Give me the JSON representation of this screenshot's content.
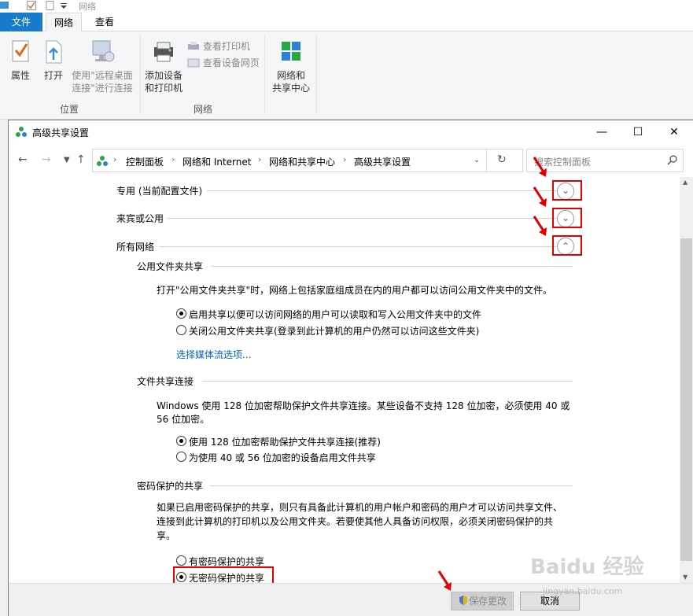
{
  "explorer": {
    "qat_title": "网络",
    "tabs": {
      "file": "文件",
      "network": "网络",
      "view": "查看"
    },
    "buttons": {
      "properties": "属性",
      "open": "打开",
      "remote_line1": "使用\"远程桌面",
      "remote_line2": "连接\"进行连接",
      "add_device_line1": "添加设备",
      "add_device_line2": "和打印机",
      "view_printers": "查看打印机",
      "view_device_page": "查看设备网页",
      "network_center_line1": "网络和",
      "network_center_line2": "共享中心"
    },
    "groups": {
      "location": "位置",
      "network": "网络"
    }
  },
  "dialog": {
    "title": "高级共享设置",
    "window_buttons": {
      "minimize": "—",
      "maximize": "☐",
      "close": "✕"
    },
    "breadcrumb": [
      "控制面板",
      "网络和 Internet",
      "网络和共享中心",
      "高级共享设置"
    ],
    "search_placeholder": "搜索控制面板",
    "profiles": {
      "private": "专用 (当前配置文件)",
      "guest": "来宾或公用",
      "all": "所有网络"
    },
    "public_folder": {
      "heading": "公用文件夹共享",
      "desc": "打开\"公用文件夹共享\"时，网络上包括家庭组成员在内的用户都可以访问公用文件夹中的文件。",
      "opt_on": "启用共享以便可以访问网络的用户可以读取和写入公用文件夹中的文件",
      "opt_off": "关闭公用文件夹共享(登录到此计算机的用户仍然可以访问这些文件夹)",
      "media_link": "选择媒体流选项..."
    },
    "file_sharing": {
      "heading": "文件共享连接",
      "desc_line1": "Windows 使用 128 位加密帮助保护文件共享连接。某些设备不支持 128 位加密，必须使用 40 或",
      "desc_line2": "56 位加密。",
      "opt_128": "使用 128 位加密帮助保护文件共享连接(推荐)",
      "opt_40": "为使用 40 或 56 位加密的设备启用文件共享"
    },
    "password": {
      "heading": "密码保护的共享",
      "desc_line1": "如果已启用密码保护的共享，则只有具备此计算机的用户帐户和密码的用户才可以访问共享文件、",
      "desc_line2": "连接到此计算机的打印机以及公用文件夹。若要使其他人具备访问权限，必须关闭密码保护的共",
      "desc_line3": "享。",
      "opt_on": "有密码保护的共享",
      "opt_off": "无密码保护的共享"
    },
    "footer": {
      "save": "保存更改",
      "cancel": "取消"
    }
  },
  "watermark": {
    "brand": "Baidu 经验",
    "url": "jingyan.baidu.com"
  },
  "colors": {
    "accent": "#1979ca",
    "highlight": "#e00000",
    "link": "#0066cc"
  }
}
